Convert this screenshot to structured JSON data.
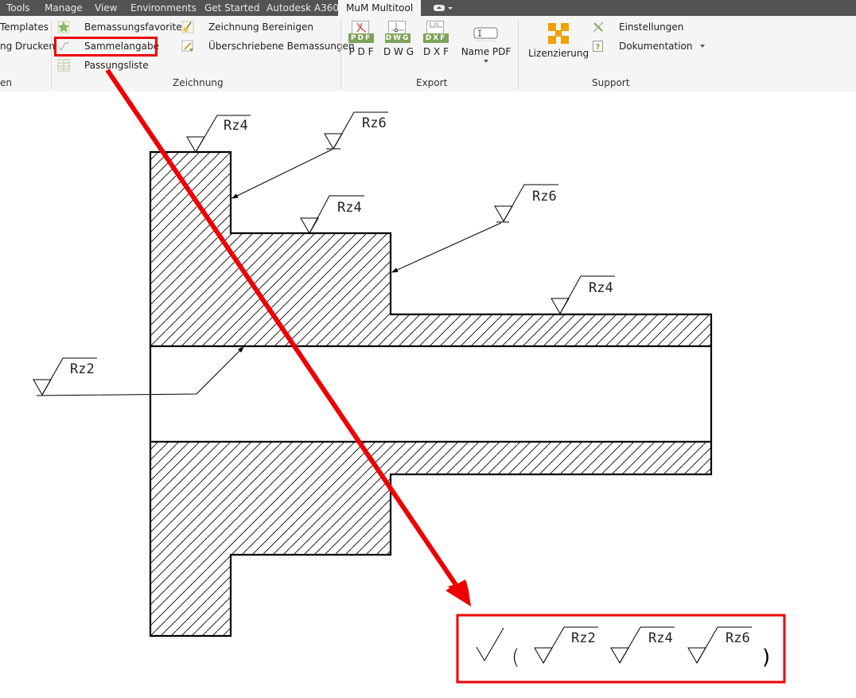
{
  "tabs": [
    {
      "label": "Tools",
      "active": false
    },
    {
      "label": "Manage",
      "active": false
    },
    {
      "label": "View",
      "active": false
    },
    {
      "label": "Environments",
      "active": false
    },
    {
      "label": "Get Started",
      "active": false
    },
    {
      "label": "Autodesk A360",
      "active": false
    },
    {
      "label": "MuM Multitool",
      "active": true
    }
  ],
  "ribbon": {
    "left_panel": {
      "items": [
        "Templates",
        "ng Drucken"
      ],
      "title": "en"
    },
    "zeichnung": {
      "title": "Zeichnung",
      "items": [
        {
          "label": "Bemassungsfavoriten",
          "icon": "star-icon"
        },
        {
          "label": "Sammelangabe",
          "icon": "surface-finish-icon",
          "highlighted": true
        },
        {
          "label": "Passungsliste",
          "icon": "table-icon"
        },
        {
          "label": "Zeichnung Bereinigen",
          "icon": "broom-icon"
        },
        {
          "label": "Überschriebene Bemassungen",
          "icon": "edit-dimension-icon"
        }
      ]
    },
    "export": {
      "title": "Export",
      "buttons": [
        {
          "label": "P D F",
          "badge": "PDF"
        },
        {
          "label": "D W G",
          "badge": "DWG"
        },
        {
          "label": "D X F",
          "badge": "DXF"
        },
        {
          "label": "Name PDF",
          "dropdown": true
        }
      ]
    },
    "support": {
      "title": "Support",
      "big_button": "Lizenzierung",
      "items": [
        {
          "label": "Einstellungen",
          "icon": "tools-icon"
        },
        {
          "label": "Dokumentation",
          "icon": "help-icon",
          "dropdown": true
        }
      ]
    }
  },
  "drawing": {
    "annotations": [
      {
        "id": "rz4-top",
        "text": "Rz4"
      },
      {
        "id": "rz6-upper",
        "text": "Rz6"
      },
      {
        "id": "rz4-mid",
        "text": "Rz4"
      },
      {
        "id": "rz6-right",
        "text": "Rz6"
      },
      {
        "id": "rz4-right",
        "text": "Rz4"
      },
      {
        "id": "rz2-bore",
        "text": "Rz2"
      }
    ],
    "summary": {
      "symbols": [
        "Rz2",
        "Rz4",
        "Rz6"
      ],
      "open_paren": "(",
      "close_paren": ")"
    },
    "colors": {
      "highlight": "#ee0000",
      "line": "#000000"
    }
  }
}
